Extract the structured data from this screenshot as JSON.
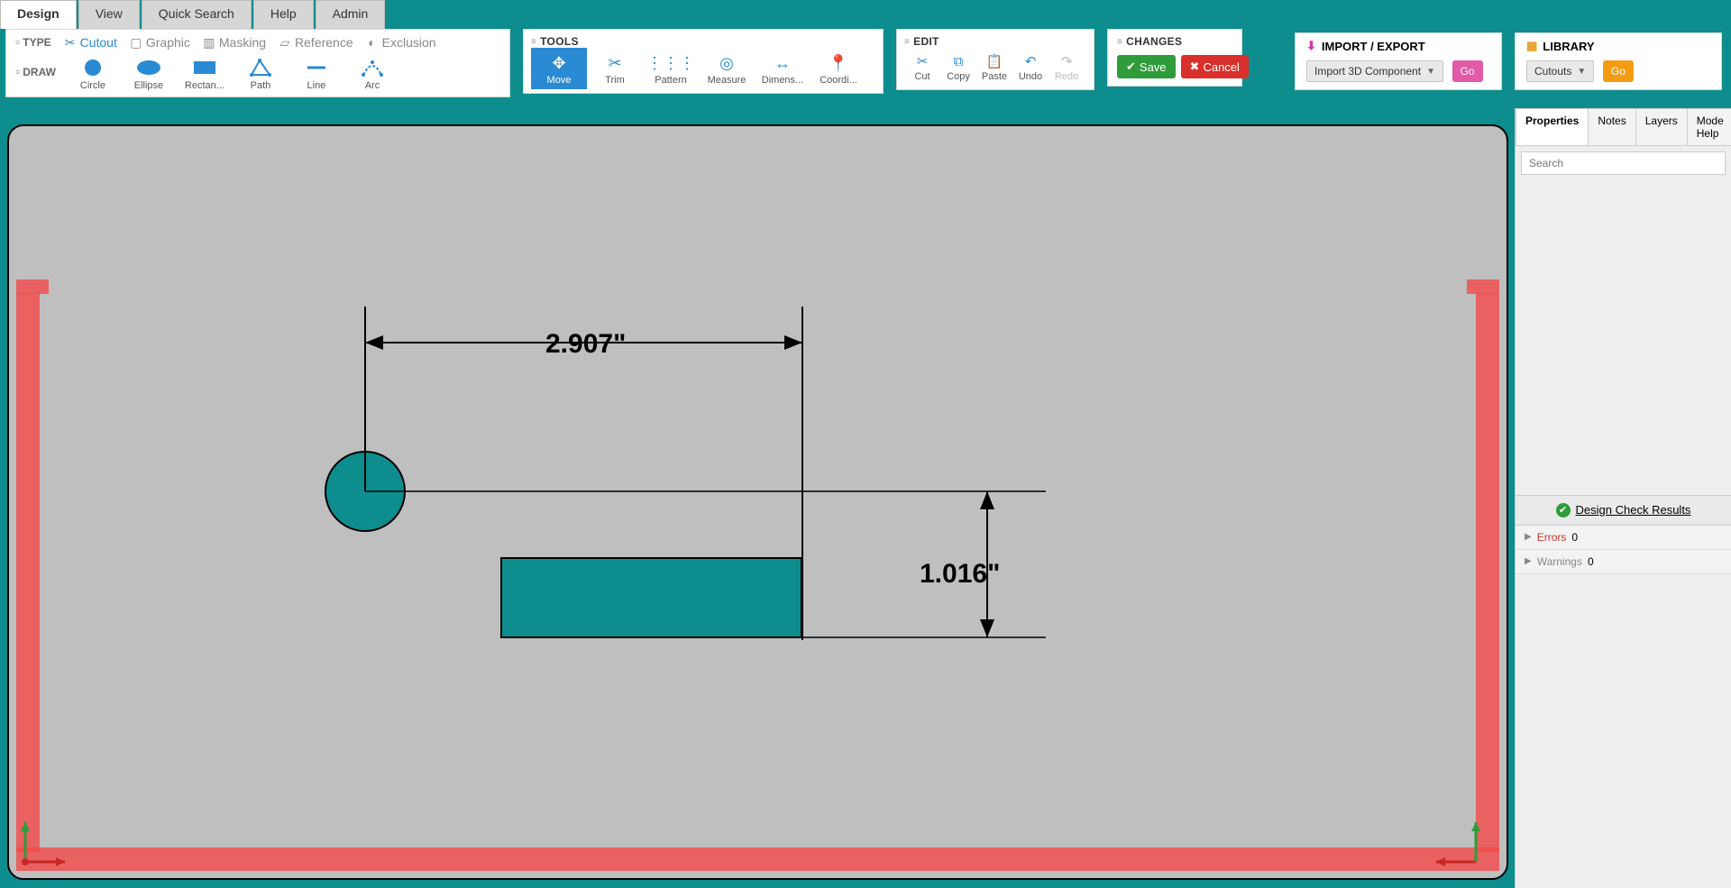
{
  "tabs": [
    "Design",
    "View",
    "Quick Search",
    "Help",
    "Admin"
  ],
  "activeTab": "Design",
  "type": {
    "label": "TYPE",
    "items": [
      "Cutout",
      "Graphic",
      "Masking",
      "Reference",
      "Exclusion"
    ],
    "active": "Cutout"
  },
  "draw": {
    "label": "DRAW",
    "items": [
      "Circle",
      "Ellipse",
      "Rectan...",
      "Path",
      "Line",
      "Arc"
    ]
  },
  "tools": {
    "label": "TOOLS",
    "items": [
      "Move",
      "Trim",
      "Pattern",
      "Measure",
      "Dimens...",
      "Coordi..."
    ],
    "active": "Move"
  },
  "edit": {
    "label": "EDIT",
    "items": [
      "Cut",
      "Copy",
      "Paste",
      "Undo",
      "Redo"
    ],
    "disabled": [
      "Redo"
    ]
  },
  "changes": {
    "label": "CHANGES",
    "save": "Save",
    "cancel": "Cancel"
  },
  "impexp": {
    "label": "IMPORT / EXPORT",
    "combo": "Import 3D Component",
    "go": "Go"
  },
  "library": {
    "label": "LIBRARY",
    "combo": "Cutouts",
    "go": "Go"
  },
  "canvas": {
    "dimH": "2.907\"",
    "dimV": "1.016\""
  },
  "side": {
    "tabs": [
      "Properties",
      "Notes",
      "Layers",
      "Mode Help"
    ],
    "activeTab": "Properties",
    "searchPlaceholder": "Search",
    "dcr": {
      "title": "Design Check Results",
      "errorsLabel": "Errors",
      "errorsCount": 0,
      "warningsLabel": "Warnings",
      "warningsCount": 0
    }
  }
}
